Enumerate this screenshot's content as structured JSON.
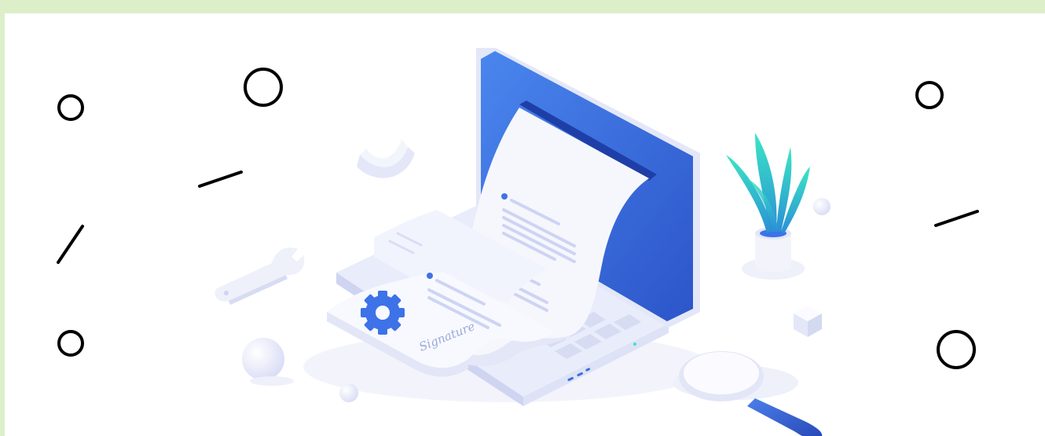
{
  "illustration": {
    "signature_text": "Signature",
    "colors": {
      "border": "#dcefc9",
      "background": "#ffffff",
      "screen_blue": "#3a6fe0",
      "device_light": "#eef0fb",
      "paper": "#f7f8fe",
      "paper_lines": "#cdd4f3",
      "accent_blue": "#3d72e8",
      "plant_green": "#2fd4a8",
      "decoration_stroke": "#000000"
    },
    "icons": [
      "laptop",
      "document",
      "gear",
      "signature",
      "plant",
      "magnifier",
      "wrench",
      "sphere",
      "cube",
      "ring"
    ]
  }
}
